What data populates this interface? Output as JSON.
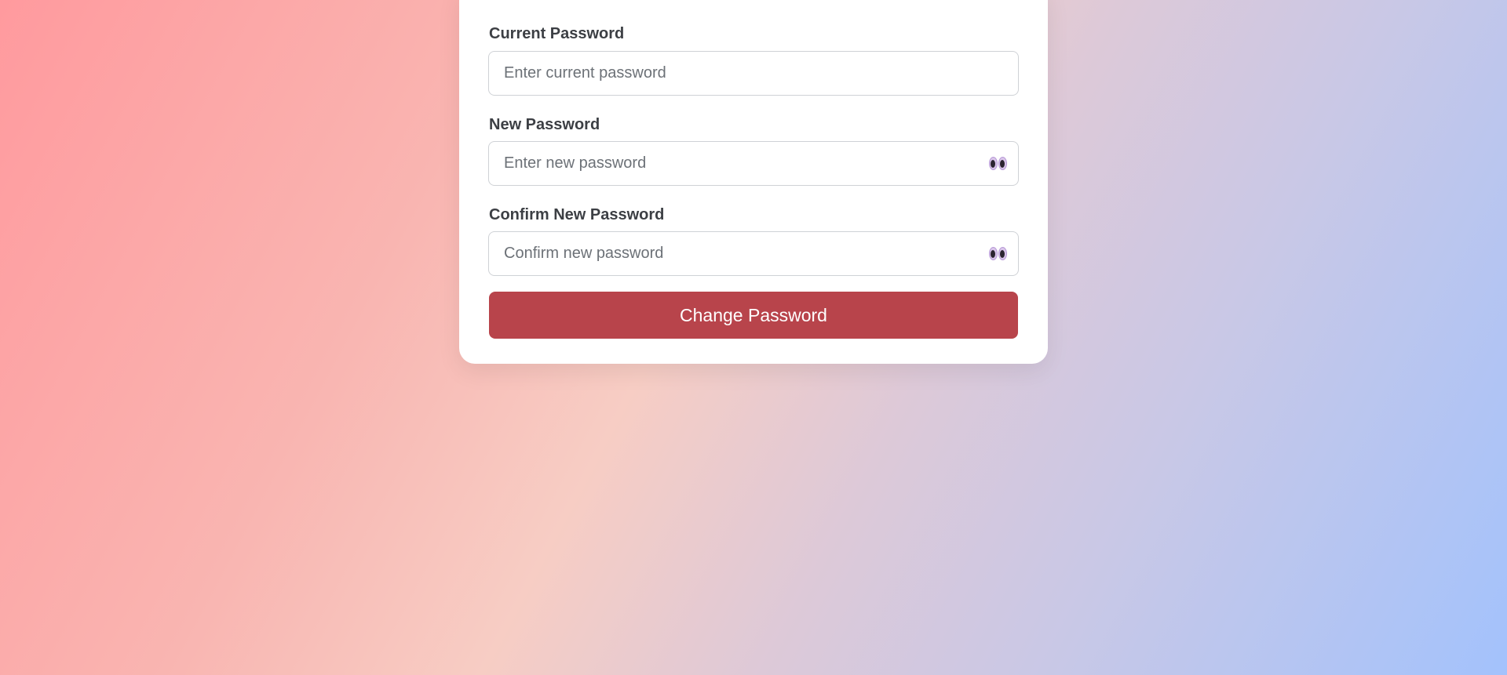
{
  "form": {
    "current_password": {
      "label": "Current Password",
      "placeholder": "Enter current password",
      "value": ""
    },
    "new_password": {
      "label": "New Password",
      "placeholder": "Enter new password",
      "value": "",
      "toggle_icon": "eyes-icon"
    },
    "confirm_password": {
      "label": "Confirm New Password",
      "placeholder": "Confirm new password",
      "value": "",
      "toggle_icon": "eyes-icon"
    },
    "submit_label": "Change Password"
  },
  "colors": {
    "button": "#b8444b",
    "card": "#ffffff",
    "background_start": "#ff9a9e",
    "background_end": "#a3c2fc"
  }
}
